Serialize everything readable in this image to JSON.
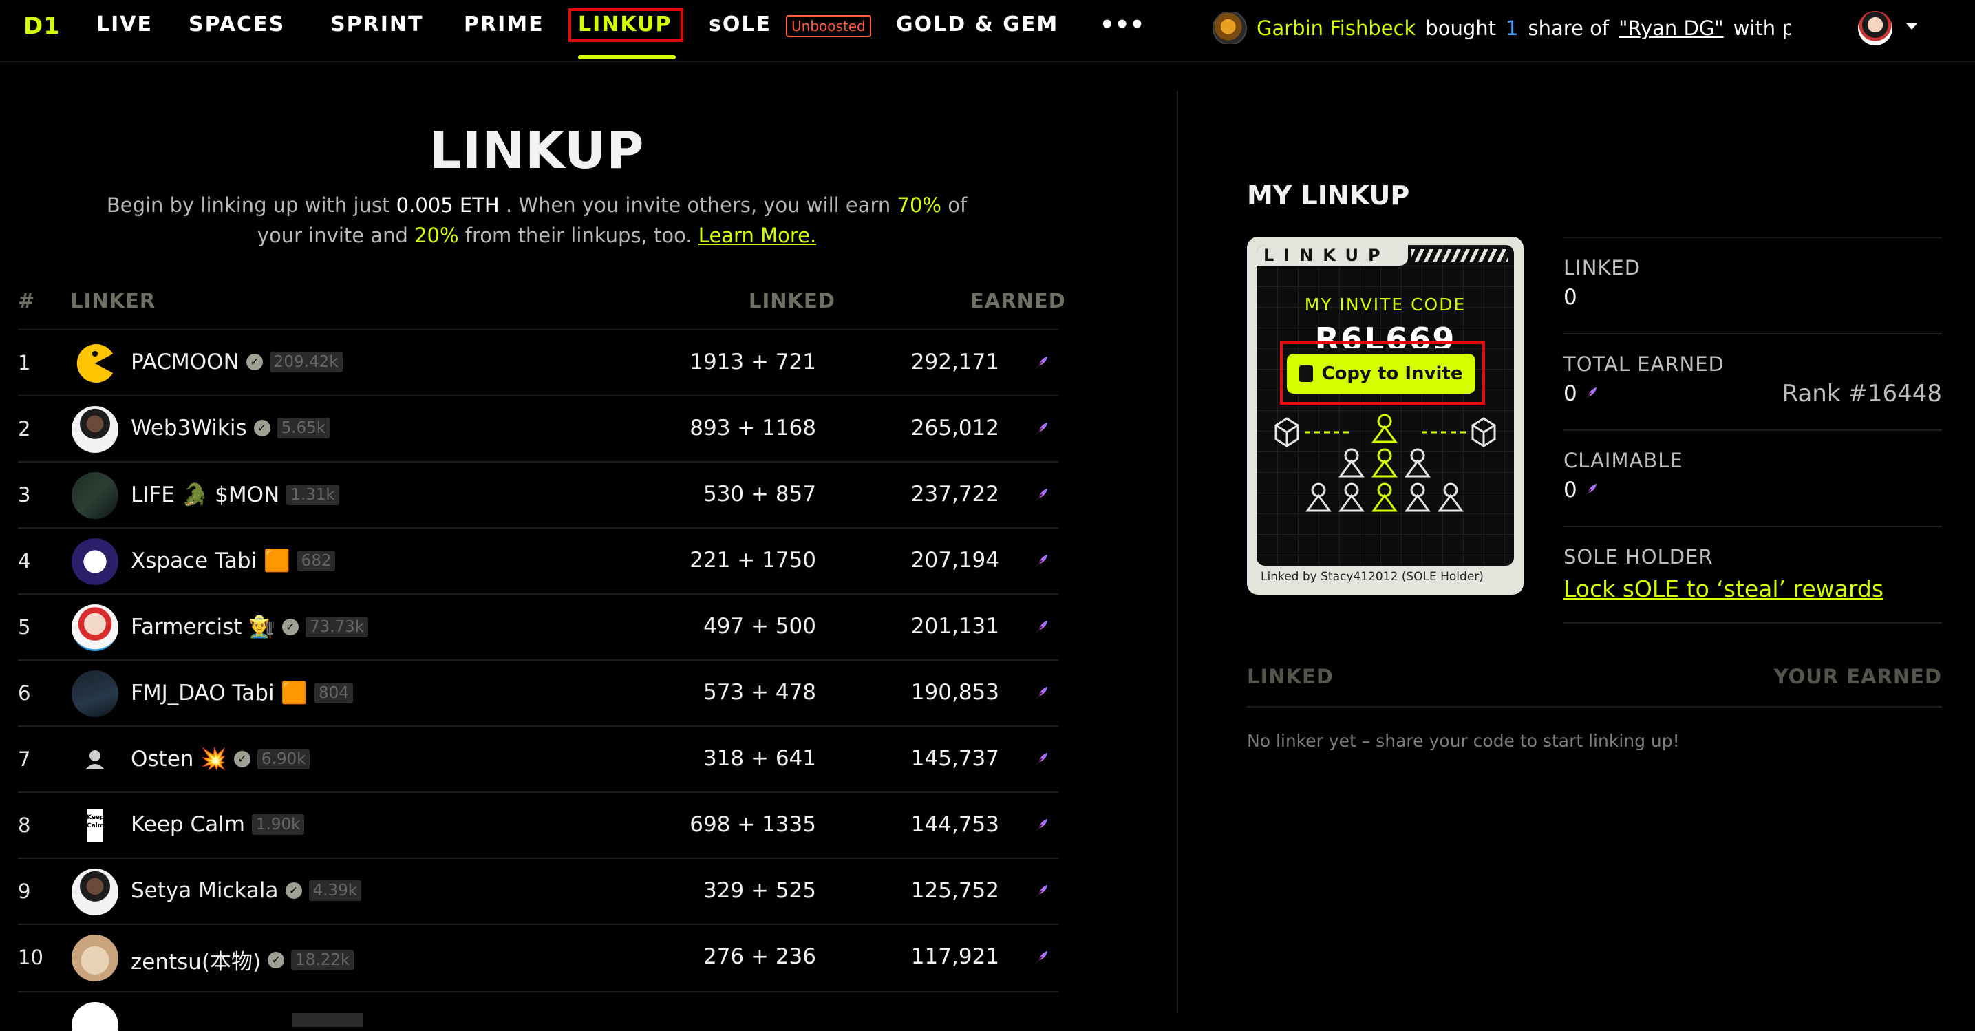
{
  "nav": {
    "logo": "D1",
    "items": [
      "LIVE",
      "SPACES",
      "SPRINT",
      "PRIME",
      "LINKUP",
      "sOLE",
      "GOLD & GEM"
    ],
    "active": "LINKUP",
    "sole_badge": "Unboosted",
    "more": "•••"
  },
  "ticker": {
    "buyer": "Garbin Fishbeck",
    "action": "bought",
    "quantity": "1",
    "share_text": "share of",
    "target": "\"Ryan DG\"",
    "suffix": "with pric..."
  },
  "colors": {
    "accent": "#d4ff00",
    "highlight_box": "#e20c0c",
    "badge": "#ff5c38"
  },
  "hero": {
    "title": "LINKUP",
    "line1_a": "Begin by linking up with just",
    "amount": "0.005 ETH",
    "line1_b": ". When you invite others, you will earn",
    "pct_invite": "70%",
    "line1_c": "of",
    "line2_a": "your invite and",
    "pct_linkups": "20%",
    "line2_b": "from their linkups, too.",
    "learn_more": "Learn More."
  },
  "table": {
    "headers": {
      "rank": "#",
      "linker": "LINKER",
      "linked": "LINKED",
      "earned": "EARNED"
    },
    "rows": [
      {
        "rank": "1",
        "name": "PACMOON",
        "verified": true,
        "followers": "209.42k",
        "linked": "1913 + 721",
        "earned": "292,171",
        "avatar": "pacman-avatar"
      },
      {
        "rank": "2",
        "name": "Web3Wikis",
        "verified": true,
        "followers": "5.65k",
        "linked": "893 + 1168",
        "earned": "265,012",
        "avatar": "person-avatar"
      },
      {
        "rank": "3",
        "name": "LIFE 🐊 $MON",
        "verified": false,
        "followers": "1.31k",
        "linked": "530 + 857",
        "earned": "237,722",
        "avatar": "scene-avatar"
      },
      {
        "rank": "4",
        "name": "Xspace Tabi 🟧",
        "verified": false,
        "followers": "682",
        "linked": "221 + 1750",
        "earned": "207,194",
        "avatar": "ball-avatar"
      },
      {
        "rank": "5",
        "name": "Farmercist 👨‍🌾",
        "verified": true,
        "followers": "73.73k",
        "linked": "497 + 500",
        "earned": "201,131",
        "avatar": "clown-avatar"
      },
      {
        "rank": "6",
        "name": "FMJ_DAO Tabi 🟧",
        "verified": false,
        "followers": "804",
        "linked": "573 + 478",
        "earned": "190,853",
        "avatar": "chart-avatar"
      },
      {
        "rank": "7",
        "name": "Osten 💥",
        "verified": true,
        "followers": "6.90k",
        "linked": "318 + 641",
        "earned": "145,737",
        "avatar": "default-avatar"
      },
      {
        "rank": "8",
        "name": "Keep Calm",
        "verified": false,
        "followers": "1.90k",
        "linked": "698 + 1335",
        "earned": "144,753",
        "avatar": "keepcalm-avatar"
      },
      {
        "rank": "9",
        "name": "Setya Mickala",
        "verified": true,
        "followers": "4.39k",
        "linked": "329 + 525",
        "earned": "125,752",
        "avatar": "person-avatar"
      },
      {
        "rank": "10",
        "name": "zentsu(本物)",
        "verified": true,
        "followers": "18.22k",
        "linked": "276 + 236",
        "earned": "117,921",
        "avatar": "seal-avatar"
      }
    ]
  },
  "my_linkup": {
    "title": "MY LINKUP",
    "card": {
      "brand": "LINKUP",
      "invite_label": "MY INVITE CODE",
      "invite_code": "R6L669",
      "copy_button": "Copy to Invite",
      "footer": "Linked by Stacy412012 (SOLE Holder)"
    },
    "stats": {
      "linked_label": "LINKED",
      "linked_value": "0",
      "total_label": "TOTAL EARNED",
      "total_value": "0",
      "rank": "Rank #16448",
      "claimable_label": "CLAIMABLE",
      "claimable_value": "0",
      "sole_label": "SOLE HOLDER",
      "sole_link": "Lock sOLE to ‘steal’ rewards"
    },
    "linked_table": {
      "col_linked": "LINKED",
      "col_earned": "YOUR EARNED",
      "empty": "No linker yet – share your code to start linking up!"
    }
  }
}
